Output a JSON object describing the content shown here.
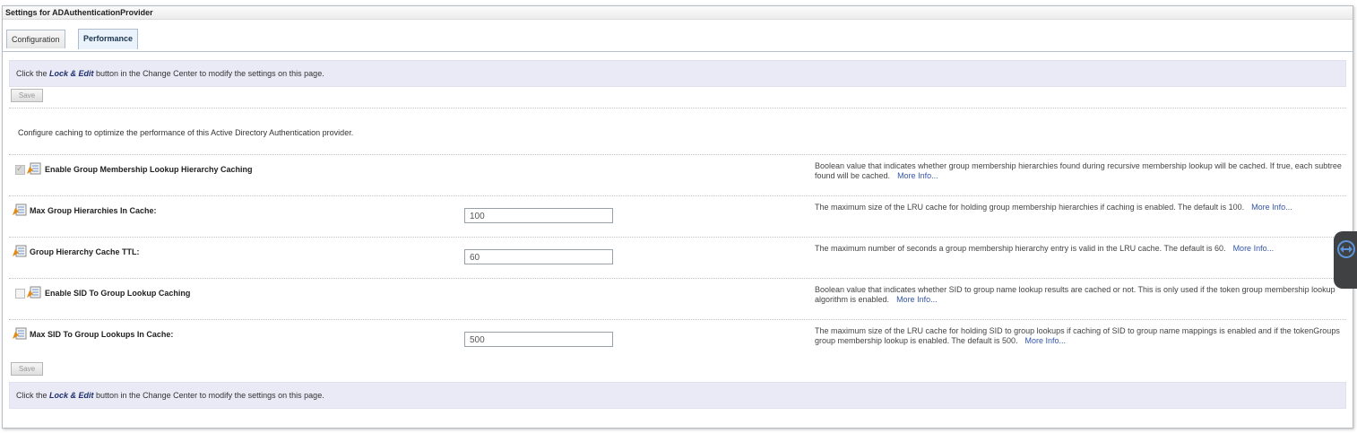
{
  "window": {
    "title": "Settings for ADAuthenticationProvider"
  },
  "tabs": [
    {
      "label": "Configuration"
    },
    {
      "label": "Performance"
    }
  ],
  "info": {
    "before": "Click the ",
    "action": "Lock & Edit",
    "after": " button in the Change Center to modify the settings on this page."
  },
  "save_label": "Save",
  "intro": "Configure caching to optimize the performance of this Active Directory Authentication provider.",
  "more_info": "More Info...",
  "fields": [
    {
      "label": "Enable Group Membership Lookup Hierarchy Caching",
      "type": "checkbox",
      "checked": true,
      "description": "Boolean value that indicates whether group membership hierarchies found during recursive membership lookup will be cached. If true, each subtree found will be cached."
    },
    {
      "label": "Max Group Hierarchies In Cache:",
      "type": "text",
      "value": "100",
      "description": "The maximum size of the LRU cache for holding group membership hierarchies if caching is enabled. The default is 100."
    },
    {
      "label": "Group Hierarchy Cache TTL:",
      "type": "text",
      "value": "60",
      "description": "The maximum number of seconds a group membership hierarchy entry is valid in the LRU cache. The default is 60."
    },
    {
      "label": "Enable SID To Group Lookup Caching",
      "type": "checkbox",
      "checked": false,
      "description": "Boolean value that indicates whether SID to group name lookup results are cached or not. This is only used if the token group membership lookup algorithm is enabled."
    },
    {
      "label": "Max SID To Group Lookups In Cache:",
      "type": "text",
      "value": "500",
      "description": "The maximum size of the LRU cache for holding SID to group lookups if caching of SID to group name mappings is enabled and if the tokenGroups group membership lookup is enabled. The default is 500."
    }
  ],
  "icons": {
    "field_icon": "config-policy-icon",
    "side_tab": "resize-arrows-icon"
  },
  "colors": {
    "info_bar": "#e9eaf6",
    "link": "#3355a8",
    "lock_edit": "#1d2f6b"
  }
}
